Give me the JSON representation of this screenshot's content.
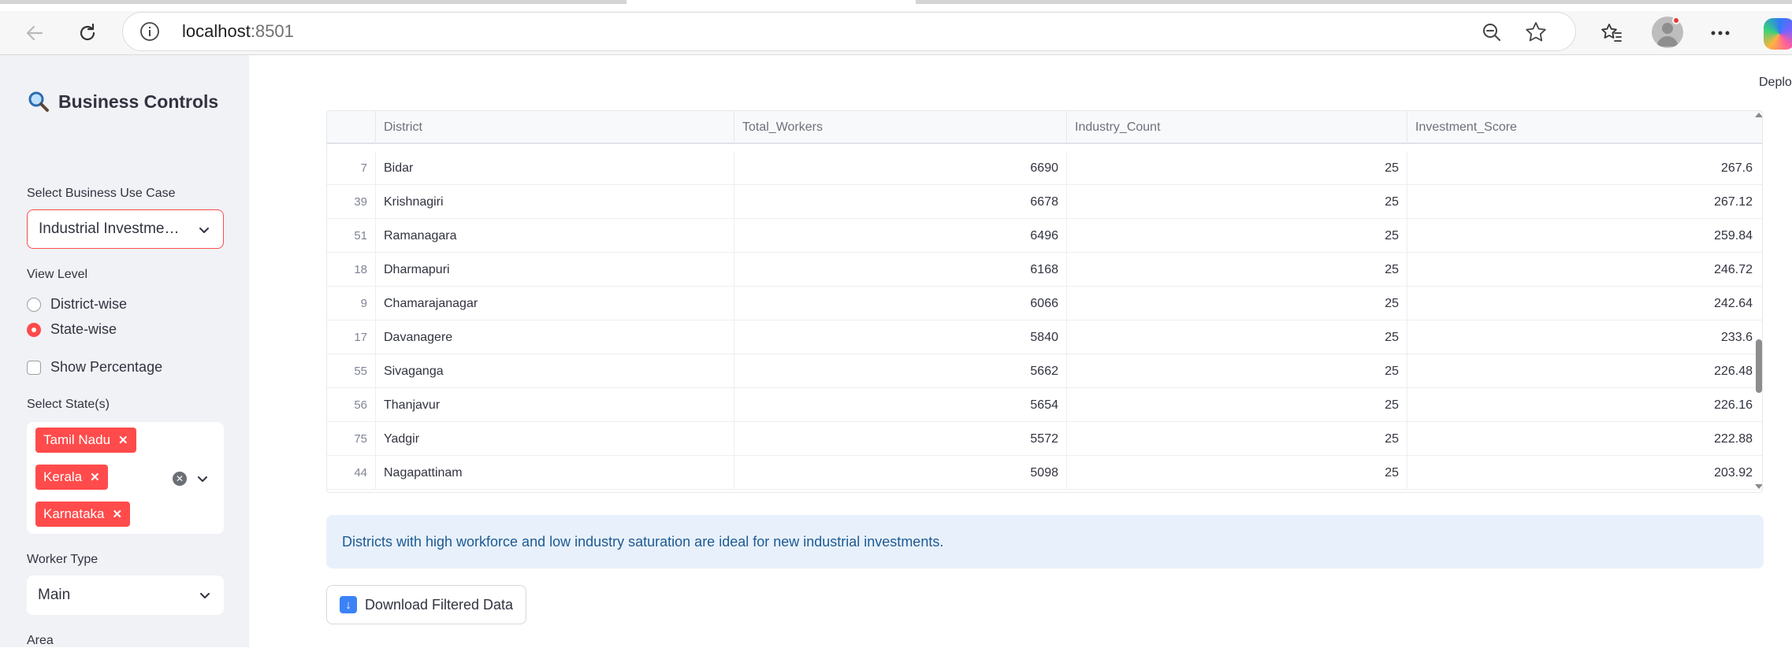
{
  "browser": {
    "url_host": "localhost",
    "url_port": ":8501"
  },
  "header": {
    "deploy_label": "Deplo"
  },
  "sidebar": {
    "title": "Business Controls",
    "use_case_label": "Select Business Use Case",
    "use_case_value": "Industrial Investme…",
    "view_level_label": "View Level",
    "view_options": [
      "District-wise",
      "State-wise"
    ],
    "view_selected": "State-wise",
    "show_percentage_label": "Show Percentage",
    "states_label": "Select State(s)",
    "states": [
      "Tamil Nadu",
      "Kerala",
      "Karnataka"
    ],
    "worker_type_label": "Worker Type",
    "worker_type_value": "Main",
    "area_label": "Area"
  },
  "table": {
    "columns": [
      "District",
      "Total_Workers",
      "Industry_Count",
      "Investment_Score"
    ],
    "rows": [
      {
        "idx": "7",
        "district": "Bidar",
        "total_workers": "6690",
        "industry_count": "25",
        "investment_score": "267.6"
      },
      {
        "idx": "39",
        "district": "Krishnagiri",
        "total_workers": "6678",
        "industry_count": "25",
        "investment_score": "267.12"
      },
      {
        "idx": "51",
        "district": "Ramanagara",
        "total_workers": "6496",
        "industry_count": "25",
        "investment_score": "259.84"
      },
      {
        "idx": "18",
        "district": "Dharmapuri",
        "total_workers": "6168",
        "industry_count": "25",
        "investment_score": "246.72"
      },
      {
        "idx": "9",
        "district": "Chamarajanagar",
        "total_workers": "6066",
        "industry_count": "25",
        "investment_score": "242.64"
      },
      {
        "idx": "17",
        "district": "Davanagere",
        "total_workers": "5840",
        "industry_count": "25",
        "investment_score": "233.6"
      },
      {
        "idx": "55",
        "district": "Sivaganga",
        "total_workers": "5662",
        "industry_count": "25",
        "investment_score": "226.48"
      },
      {
        "idx": "56",
        "district": "Thanjavur",
        "total_workers": "5654",
        "industry_count": "25",
        "investment_score": "226.16"
      },
      {
        "idx": "75",
        "district": "Yadgir",
        "total_workers": "5572",
        "industry_count": "25",
        "investment_score": "222.88"
      },
      {
        "idx": "44",
        "district": "Nagapattinam",
        "total_workers": "5098",
        "industry_count": "25",
        "investment_score": "203.92"
      }
    ]
  },
  "info_message": "Districts with high workforce and low industry saturation are ideal for new industrial investments.",
  "download_label": "Download Filtered Data",
  "colors": {
    "accent": "#ff4b4b",
    "sidebar_bg": "#f0f2f6",
    "info_bg": "#e8f1fb",
    "info_text": "#1d5a93"
  }
}
